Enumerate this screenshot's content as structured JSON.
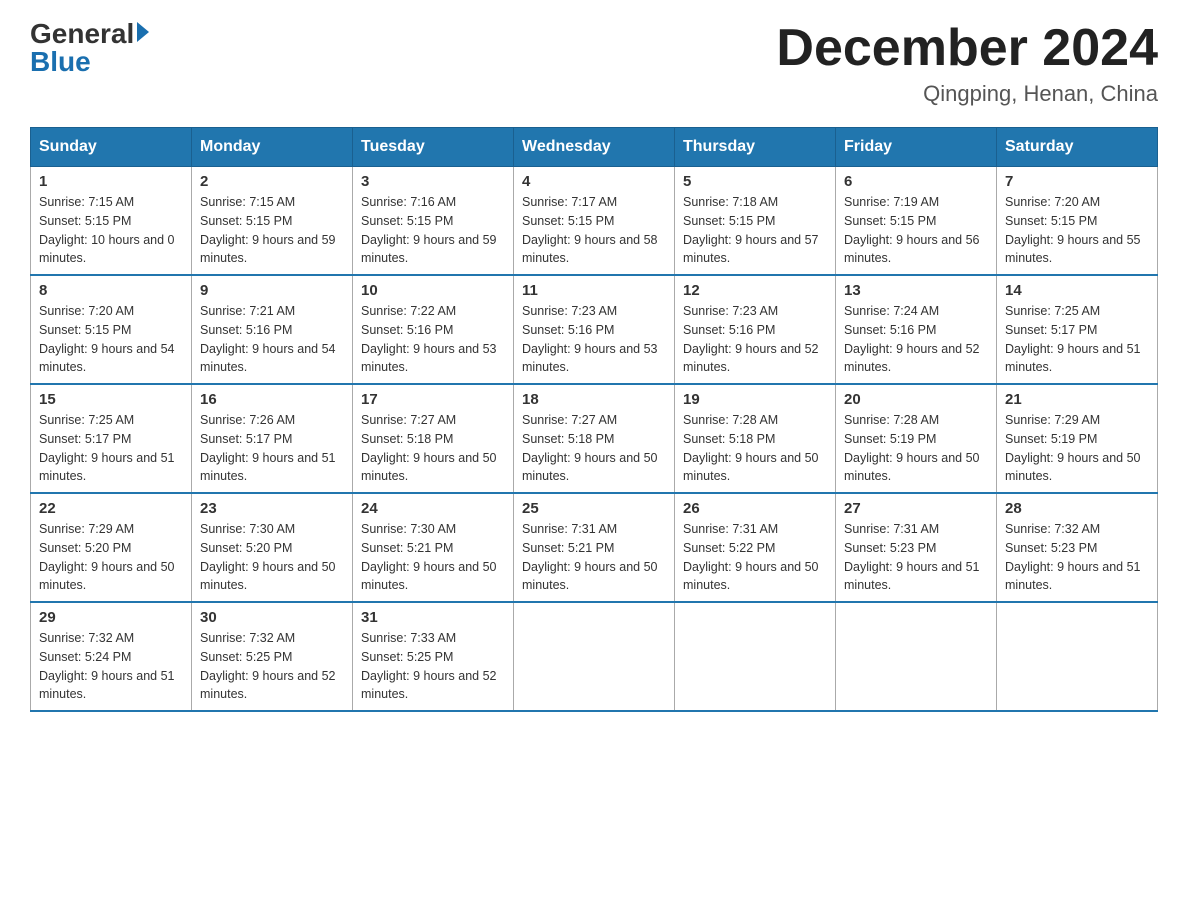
{
  "header": {
    "logo_general": "General",
    "logo_blue": "Blue",
    "month_year": "December 2024",
    "location": "Qingping, Henan, China"
  },
  "days_of_week": [
    "Sunday",
    "Monday",
    "Tuesday",
    "Wednesday",
    "Thursday",
    "Friday",
    "Saturday"
  ],
  "weeks": [
    [
      {
        "day": "1",
        "sunrise": "7:15 AM",
        "sunset": "5:15 PM",
        "daylight": "10 hours and 0 minutes."
      },
      {
        "day": "2",
        "sunrise": "7:15 AM",
        "sunset": "5:15 PM",
        "daylight": "9 hours and 59 minutes."
      },
      {
        "day": "3",
        "sunrise": "7:16 AM",
        "sunset": "5:15 PM",
        "daylight": "9 hours and 59 minutes."
      },
      {
        "day": "4",
        "sunrise": "7:17 AM",
        "sunset": "5:15 PM",
        "daylight": "9 hours and 58 minutes."
      },
      {
        "day": "5",
        "sunrise": "7:18 AM",
        "sunset": "5:15 PM",
        "daylight": "9 hours and 57 minutes."
      },
      {
        "day": "6",
        "sunrise": "7:19 AM",
        "sunset": "5:15 PM",
        "daylight": "9 hours and 56 minutes."
      },
      {
        "day": "7",
        "sunrise": "7:20 AM",
        "sunset": "5:15 PM",
        "daylight": "9 hours and 55 minutes."
      }
    ],
    [
      {
        "day": "8",
        "sunrise": "7:20 AM",
        "sunset": "5:15 PM",
        "daylight": "9 hours and 54 minutes."
      },
      {
        "day": "9",
        "sunrise": "7:21 AM",
        "sunset": "5:16 PM",
        "daylight": "9 hours and 54 minutes."
      },
      {
        "day": "10",
        "sunrise": "7:22 AM",
        "sunset": "5:16 PM",
        "daylight": "9 hours and 53 minutes."
      },
      {
        "day": "11",
        "sunrise": "7:23 AM",
        "sunset": "5:16 PM",
        "daylight": "9 hours and 53 minutes."
      },
      {
        "day": "12",
        "sunrise": "7:23 AM",
        "sunset": "5:16 PM",
        "daylight": "9 hours and 52 minutes."
      },
      {
        "day": "13",
        "sunrise": "7:24 AM",
        "sunset": "5:16 PM",
        "daylight": "9 hours and 52 minutes."
      },
      {
        "day": "14",
        "sunrise": "7:25 AM",
        "sunset": "5:17 PM",
        "daylight": "9 hours and 51 minutes."
      }
    ],
    [
      {
        "day": "15",
        "sunrise": "7:25 AM",
        "sunset": "5:17 PM",
        "daylight": "9 hours and 51 minutes."
      },
      {
        "day": "16",
        "sunrise": "7:26 AM",
        "sunset": "5:17 PM",
        "daylight": "9 hours and 51 minutes."
      },
      {
        "day": "17",
        "sunrise": "7:27 AM",
        "sunset": "5:18 PM",
        "daylight": "9 hours and 50 minutes."
      },
      {
        "day": "18",
        "sunrise": "7:27 AM",
        "sunset": "5:18 PM",
        "daylight": "9 hours and 50 minutes."
      },
      {
        "day": "19",
        "sunrise": "7:28 AM",
        "sunset": "5:18 PM",
        "daylight": "9 hours and 50 minutes."
      },
      {
        "day": "20",
        "sunrise": "7:28 AM",
        "sunset": "5:19 PM",
        "daylight": "9 hours and 50 minutes."
      },
      {
        "day": "21",
        "sunrise": "7:29 AM",
        "sunset": "5:19 PM",
        "daylight": "9 hours and 50 minutes."
      }
    ],
    [
      {
        "day": "22",
        "sunrise": "7:29 AM",
        "sunset": "5:20 PM",
        "daylight": "9 hours and 50 minutes."
      },
      {
        "day": "23",
        "sunrise": "7:30 AM",
        "sunset": "5:20 PM",
        "daylight": "9 hours and 50 minutes."
      },
      {
        "day": "24",
        "sunrise": "7:30 AM",
        "sunset": "5:21 PM",
        "daylight": "9 hours and 50 minutes."
      },
      {
        "day": "25",
        "sunrise": "7:31 AM",
        "sunset": "5:21 PM",
        "daylight": "9 hours and 50 minutes."
      },
      {
        "day": "26",
        "sunrise": "7:31 AM",
        "sunset": "5:22 PM",
        "daylight": "9 hours and 50 minutes."
      },
      {
        "day": "27",
        "sunrise": "7:31 AM",
        "sunset": "5:23 PM",
        "daylight": "9 hours and 51 minutes."
      },
      {
        "day": "28",
        "sunrise": "7:32 AM",
        "sunset": "5:23 PM",
        "daylight": "9 hours and 51 minutes."
      }
    ],
    [
      {
        "day": "29",
        "sunrise": "7:32 AM",
        "sunset": "5:24 PM",
        "daylight": "9 hours and 51 minutes."
      },
      {
        "day": "30",
        "sunrise": "7:32 AM",
        "sunset": "5:25 PM",
        "daylight": "9 hours and 52 minutes."
      },
      {
        "day": "31",
        "sunrise": "7:33 AM",
        "sunset": "5:25 PM",
        "daylight": "9 hours and 52 minutes."
      },
      null,
      null,
      null,
      null
    ]
  ]
}
